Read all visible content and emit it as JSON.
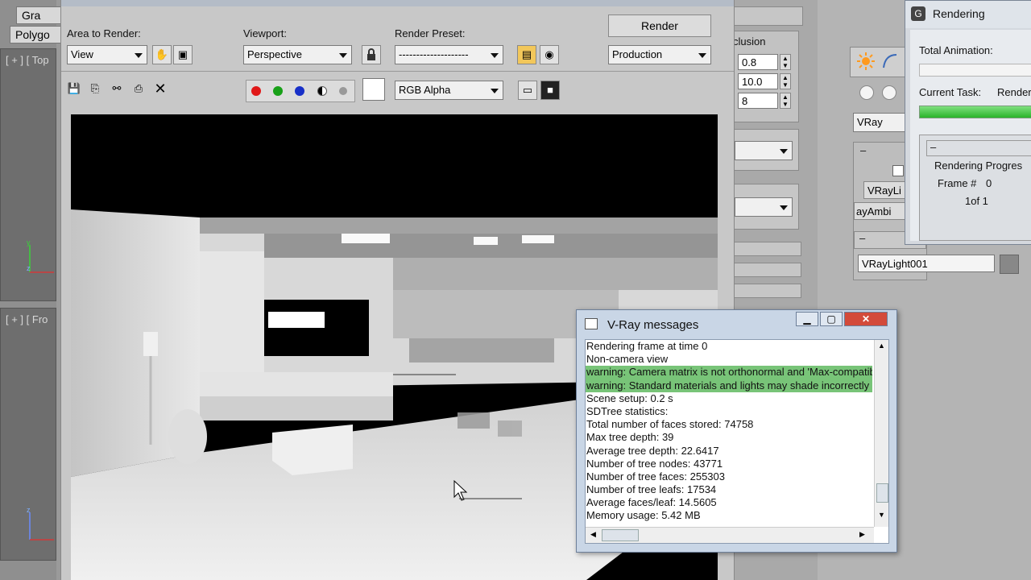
{
  "left_strip": {
    "tab_top": "Gra",
    "tab_bottom": "Polygo",
    "viewport_top_label": "[ + ] [ Top",
    "viewport_front_label": "[ + ] [ Fro"
  },
  "render_window": {
    "area_to_render_label": "Area to Render:",
    "area_to_render_value": "View",
    "viewport_label": "Viewport:",
    "viewport_value": "Perspective",
    "render_preset_label": "Render Preset:",
    "render_preset_value": "--------------------",
    "render_button": "Render",
    "render_mode_value": "Production",
    "channel_value": "RGB Alpha"
  },
  "right_panel": {
    "occlusion_label": "clusion",
    "spinner_1": "0.8",
    "spinner_2": "10.0",
    "spinner_3": "8",
    "renderer_value": "VRay",
    "vray_button_1": "VRayLi",
    "vray_button_2": "ayAmbi",
    "rollout_minus": "–",
    "light_name": "VRayLight001"
  },
  "rendering_progress": {
    "title": "Rendering",
    "total_animation_label": "Total Animation:",
    "current_task_label": "Current Task:",
    "current_task_value": "Render",
    "rollout_minus": "–",
    "group_label": "Rendering Progres",
    "frame_label": "Frame #",
    "frame_value": "0",
    "frame_count": "1of 1"
  },
  "vray_messages": {
    "title": "V-Ray messages",
    "lines": [
      {
        "text": "Rendering frame at time 0",
        "warn": false
      },
      {
        "text": "Non-camera view",
        "warn": false
      },
      {
        "text": "warning: Camera matrix is not orthonormal and 'Max-compatib",
        "warn": true
      },
      {
        "text": "warning: Standard materials and lights may shade incorrectly",
        "warn": true
      },
      {
        "text": "Scene setup: 0.2 s",
        "warn": false
      },
      {
        "text": "SDTree statistics:",
        "warn": false
      },
      {
        "text": "Total number of faces stored: 74758",
        "warn": false
      },
      {
        "text": "Max tree depth: 39",
        "warn": false
      },
      {
        "text": "Average tree depth: 22.6417",
        "warn": false
      },
      {
        "text": "Number of tree nodes: 43771",
        "warn": false
      },
      {
        "text": "Number of tree faces: 255303",
        "warn": false
      },
      {
        "text": "Number of tree leafs: 17534",
        "warn": false
      },
      {
        "text": "Average faces/leaf: 14.5605",
        "warn": false
      },
      {
        "text": "Memory usage: 5.42 MB",
        "warn": false
      }
    ]
  },
  "colors": {
    "warning_highlight": "#78c478",
    "progress_green": "#3cc83c",
    "window_frame": "#c9d6e6"
  }
}
